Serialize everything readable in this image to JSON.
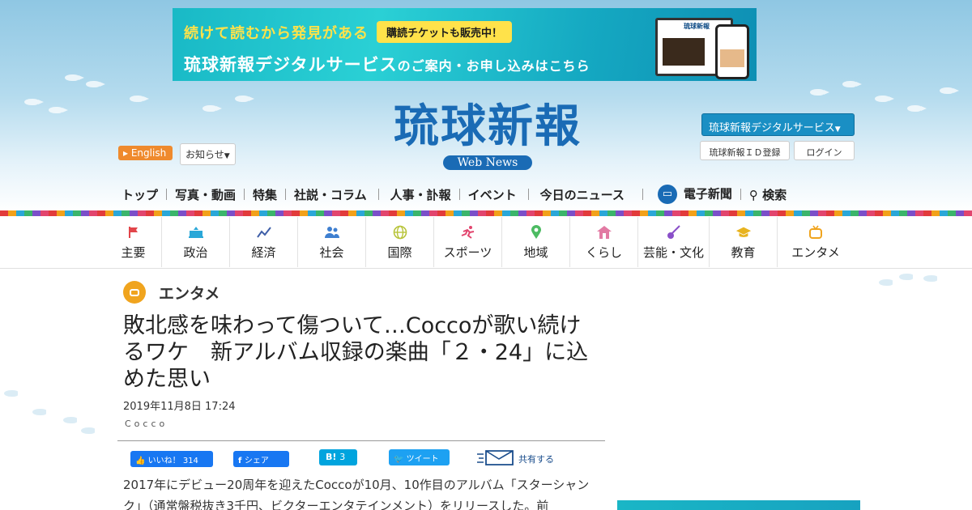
{
  "banner": {
    "line1": "続けて読むから発見がある",
    "ticket": "購読チケットも販売中！",
    "line2_main": "琉球新報デジタルサービス",
    "line2_small": "のご案内・お申し込みはこちら",
    "device_logo": "琉球新報"
  },
  "header": {
    "logo_text": "琉球新報",
    "logo_sub": "Web News",
    "english_label": "English",
    "notice_label": "お知らせ",
    "digital_label": "琉球新報デジタルサービス",
    "id_register_label": "琉球新報ＩＤ登録",
    "login_label": "ログイン"
  },
  "main_nav": {
    "items": [
      "トップ",
      "写真・動画",
      "特集",
      "社説・コラム",
      "人事・訃報",
      "イベント",
      "今日のニュース",
      "電子新聞",
      "検索"
    ]
  },
  "categories": [
    {
      "label": "主要",
      "icon": "flag-icon",
      "color": "#e2454a"
    },
    {
      "label": "政治",
      "icon": "parliament-icon",
      "color": "#2aa7d8"
    },
    {
      "label": "経済",
      "icon": "chart-icon",
      "color": "#3f5fa8"
    },
    {
      "label": "社会",
      "icon": "people-icon",
      "color": "#3e7fd0"
    },
    {
      "label": "国際",
      "icon": "globe-icon",
      "color": "#b8c43a"
    },
    {
      "label": "スポーツ",
      "icon": "runner-icon",
      "color": "#e2456e"
    },
    {
      "label": "地域",
      "icon": "pin-icon",
      "color": "#4cbb62"
    },
    {
      "label": "くらし",
      "icon": "house-icon",
      "color": "#e27aa3"
    },
    {
      "label": "芸能・文化",
      "icon": "sanshin-icon",
      "color": "#8a4fc9"
    },
    {
      "label": "教育",
      "icon": "cap-icon",
      "color": "#e8b31f"
    },
    {
      "label": "エンタメ",
      "icon": "tv-icon",
      "color": "#f0a41e"
    }
  ],
  "article": {
    "section": "エンタメ",
    "title": "敗北感を味わって傷ついて…Coccoが歌い続けるワケ　新アルバム収録の楽曲「２・24」に込めた思い",
    "date": "2019年11月8日 17:24",
    "tag": "Cocco",
    "body": "2017年にデビュー20周年を迎えたCoccoが10月、10作目のアルバム「スターシャンク」（通常盤税抜き3千円、ビクターエンタテインメント）をリリースした。前"
  },
  "share": {
    "fb_like": "いいね！",
    "fb_count": "314",
    "fb_share": "シェア",
    "hatena_label": "B!",
    "hatena_count": "3",
    "tweet": "ツイート",
    "mail_share": "共有する"
  }
}
